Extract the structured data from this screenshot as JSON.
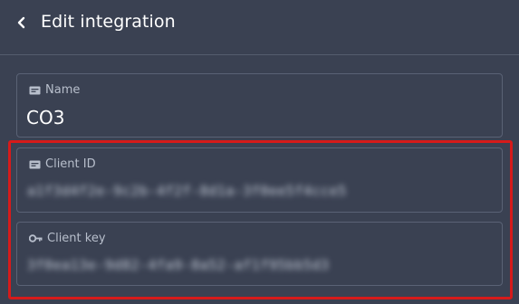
{
  "header": {
    "title": "Edit integration",
    "back_icon": "chevron-left-icon"
  },
  "fields": {
    "name": {
      "label": "Name",
      "icon": "id-card-icon",
      "value": "CO3"
    },
    "client_id": {
      "label": "Client ID",
      "icon": "id-card-icon",
      "value": "a1f3d4f2e-9c2b-4f2f-8d1a-3f0ee5f4cce5"
    },
    "client_key": {
      "label": "Client key",
      "icon": "key-icon",
      "value": "3f0ea13e-9d82-4fa9-8a52-af1f95bb5d3"
    }
  },
  "colors": {
    "background": "#3a4152",
    "border": "#5a6275",
    "highlight": "#d61a1a"
  }
}
